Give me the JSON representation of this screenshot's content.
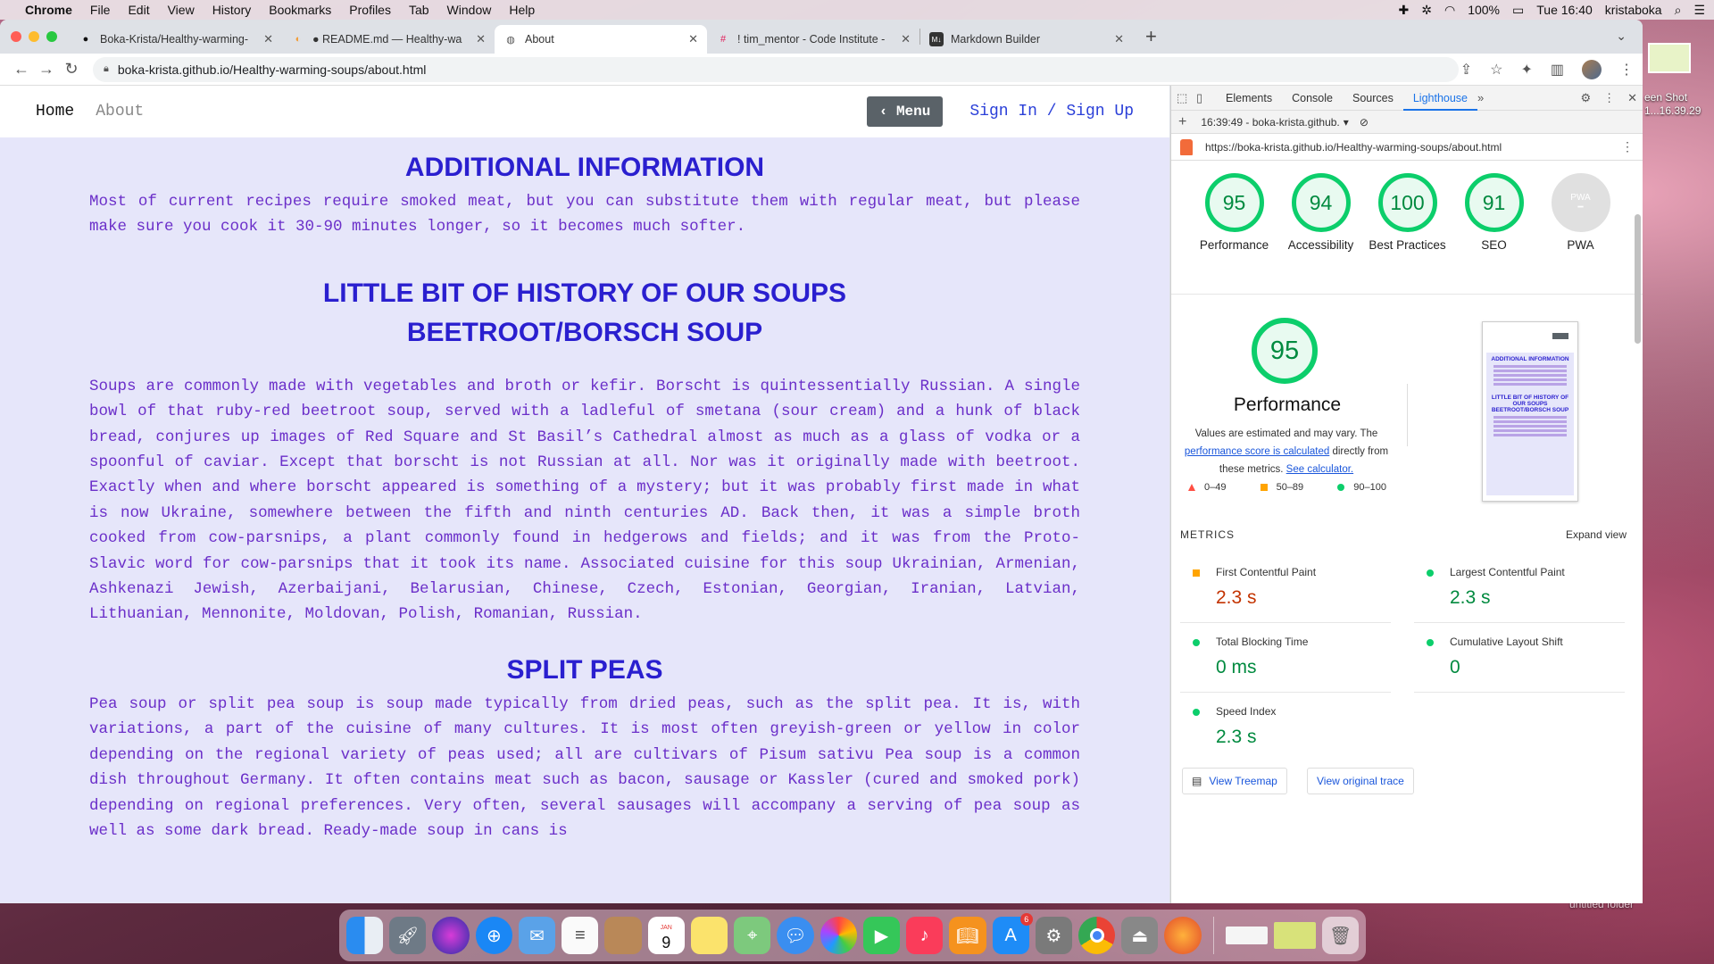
{
  "menubar": {
    "app": "Chrome",
    "menus": [
      "File",
      "Edit",
      "View",
      "History",
      "Bookmarks",
      "Profiles",
      "Tab",
      "Window",
      "Help"
    ],
    "battery": "100%",
    "clock": "Tue 16:40",
    "user": "kristaboka"
  },
  "desktop": {
    "screenshot_label_1": "een Shot",
    "screenshot_label_2": "1...16.39.29",
    "folder_label": "untitled folder"
  },
  "browser": {
    "tabs": [
      {
        "title": "Boka-Krista/Healthy-warming-",
        "icon": "github-icon"
      },
      {
        "title": "● README.md — Healthy-wa",
        "icon": "gitpod-icon"
      },
      {
        "title": "About",
        "icon": "globe-icon",
        "active": true
      },
      {
        "title": "! tim_mentor - Code Institute -",
        "icon": "slack-icon"
      },
      {
        "title": "Markdown Builder",
        "icon": "markdown-icon"
      }
    ],
    "url": "boka-krista.github.io/Healthy-warming-soups/about.html"
  },
  "site": {
    "nav_home": "Home",
    "nav_about": "About",
    "menu_button": "‹ Menu",
    "sign_in": "Sign In / Sign Up",
    "h_additional": "ADDITIONAL INFORMATION",
    "p_additional": "Most of current recipes require smoked meat, but you can substitute them with regular meat, but please make sure you cook it 30-90 minutes longer, so it becomes much softer.",
    "h_history": "LITTLE BIT OF HISTORY OF OUR SOUPS",
    "h_beetroot": "BEETROOT/BORSCH SOUP",
    "p_beetroot": "Soups are commonly made with vegetables and broth or kefir. Borscht is quintessentially Russian. A single bowl of that ruby-red beetroot soup, served with a ladleful of smetana (sour cream) and a hunk of black bread, conjures up images of Red Square and St Basil’s Cathedral almost as much as a glass of vodka or a spoonful of caviar. Except that borscht is not Russian at all. Nor was it originally made with beetroot. Exactly when and where borscht appeared is something of a mystery; but it was probably first made in what is now Ukraine, somewhere between the fifth and ninth centuries AD. Back then, it was a simple broth cooked from cow-parsnips, a plant commonly found in hedgerows and fields; and it was from the Proto-Slavic word for cow-parsnips that it took its name. Associated cuisine for this soup Ukrainian, Armenian, Ashkenazi Jewish, Azerbaijani, Belarusian, Chinese, Czech, Estonian, Georgian, Iranian, Latvian, Lithuanian, Mennonite, Moldovan, Polish, Romanian, Russian.",
    "h_split": "SPLIT PEAS",
    "p_split": "Pea soup or split pea soup is soup made typically from dried peas, such as the split pea. It is, with variations, a part of the cuisine of many cultures. It is most often greyish-green or yellow in color depending on the regional variety of peas used; all are cultivars of Pisum sativu Pea soup is a common dish throughout Germany. It often contains meat such as bacon, sausage or Kassler (cured and smoked pork) depending on regional preferences. Very often, several sausages will accompany a serving of pea soup as well as some dark bread. Ready-made soup in cans is"
  },
  "devtools": {
    "tabs": [
      "Elements",
      "Console",
      "Sources",
      "Lighthouse"
    ],
    "active_tab": "Lighthouse",
    "report_time": "16:39:49 - boka-krista.github.",
    "report_url": "https://boka-krista.github.io/Healthy-warming-soups/about.html",
    "scores": [
      {
        "label": "Performance",
        "value": "95"
      },
      {
        "label": "Accessibility",
        "value": "94"
      },
      {
        "label": "Best Practices",
        "value": "100"
      },
      {
        "label": "SEO",
        "value": "91"
      },
      {
        "label": "PWA",
        "value": "PWA"
      }
    ],
    "perf_score": "95",
    "perf_title": "Performance",
    "perf_desc_1": "Values are estimated and may vary. The",
    "perf_link": "performance score is calculated",
    "perf_desc_2": "directly from these metrics.",
    "perf_calc": "See calculator.",
    "legend": [
      "0–49",
      "50–89",
      "90–100"
    ],
    "thumb_h1": "ADDITIONAL INFORMATION",
    "thumb_h2": "LITTLE BIT OF HISTORY OF OUR SOUPS BEETROOT/BORSCH SOUP",
    "metrics_header": "METRICS",
    "expand_view": "Expand view",
    "metrics": [
      {
        "name": "First Contentful Paint",
        "value": "2.3 s",
        "status": "orange"
      },
      {
        "name": "Largest Contentful Paint",
        "value": "2.3 s",
        "status": "green"
      },
      {
        "name": "Total Blocking Time",
        "value": "0 ms",
        "status": "green"
      },
      {
        "name": "Cumulative Layout Shift",
        "value": "0",
        "status": "green"
      },
      {
        "name": "Speed Index",
        "value": "2.3 s",
        "status": "green"
      }
    ],
    "view_treemap": "View Treemap",
    "view_trace": "View original trace"
  },
  "dock": {
    "apps": [
      "finder-icon",
      "launchpad-icon",
      "siri-icon",
      "safari-icon",
      "mail-icon",
      "reminders-icon",
      "notes-icon",
      "calendar-icon",
      "stickies-icon",
      "maps-icon",
      "messages-icon",
      "photos-icon",
      "facetime-icon",
      "music-icon",
      "books-icon",
      "app-store-icon",
      "system-preferences-icon",
      "chrome-icon",
      "utility-icon",
      "firefox-icon"
    ],
    "calendar_day": "9",
    "calendar_month": "JAN",
    "app_store_badge": "6"
  },
  "colors": {
    "page_bg": "#e6e6fa",
    "heading": "#2a1fcf",
    "body_text": "#6b2fc9",
    "score_green": "#0cce6b",
    "score_orange": "#ffa400"
  }
}
